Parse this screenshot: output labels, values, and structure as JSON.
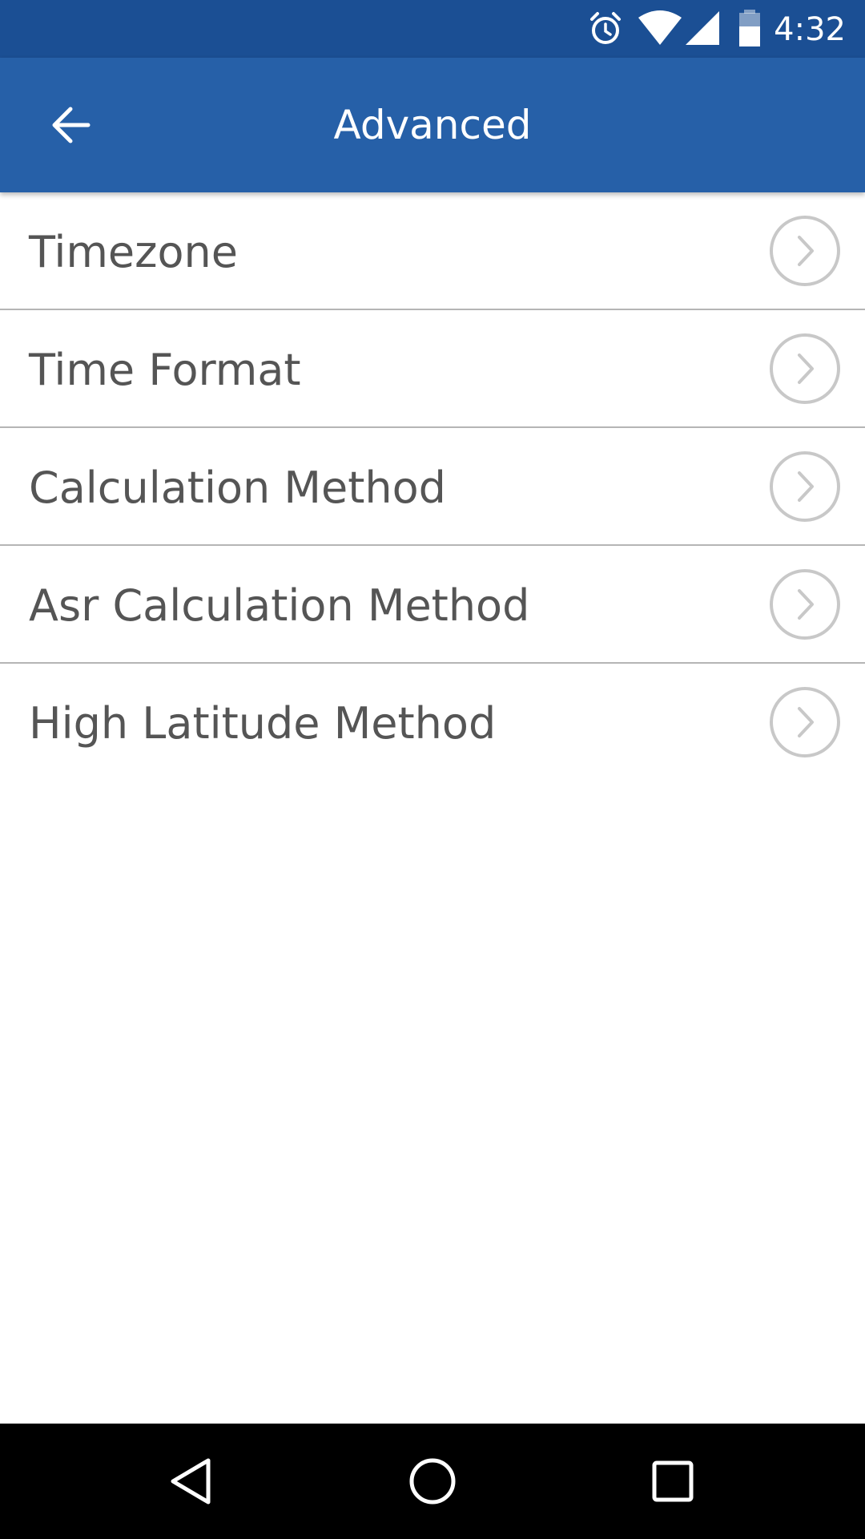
{
  "status_bar": {
    "time": "4:32",
    "icons": [
      "alarm-icon",
      "wifi-icon",
      "cell-signal-icon",
      "battery-icon"
    ]
  },
  "app_bar": {
    "title": "Advanced",
    "back_icon": "arrow-left-icon",
    "color": "#2660a8"
  },
  "settings": {
    "items": [
      {
        "label": "Timezone"
      },
      {
        "label": "Time Format"
      },
      {
        "label": "Calculation Method"
      },
      {
        "label": "Asr Calculation Method"
      },
      {
        "label": "High Latitude Method"
      }
    ],
    "chevron_icon": "chevron-right-circle-icon"
  },
  "nav_bar": {
    "buttons": [
      "back-triangle-icon",
      "home-circle-icon",
      "recents-square-icon"
    ]
  },
  "colors": {
    "status_bar": "#1b4f94",
    "app_bar": "#2660a8",
    "text": "#555555",
    "divider": "#b5b5b5",
    "chevron": "#c8c8c8"
  }
}
